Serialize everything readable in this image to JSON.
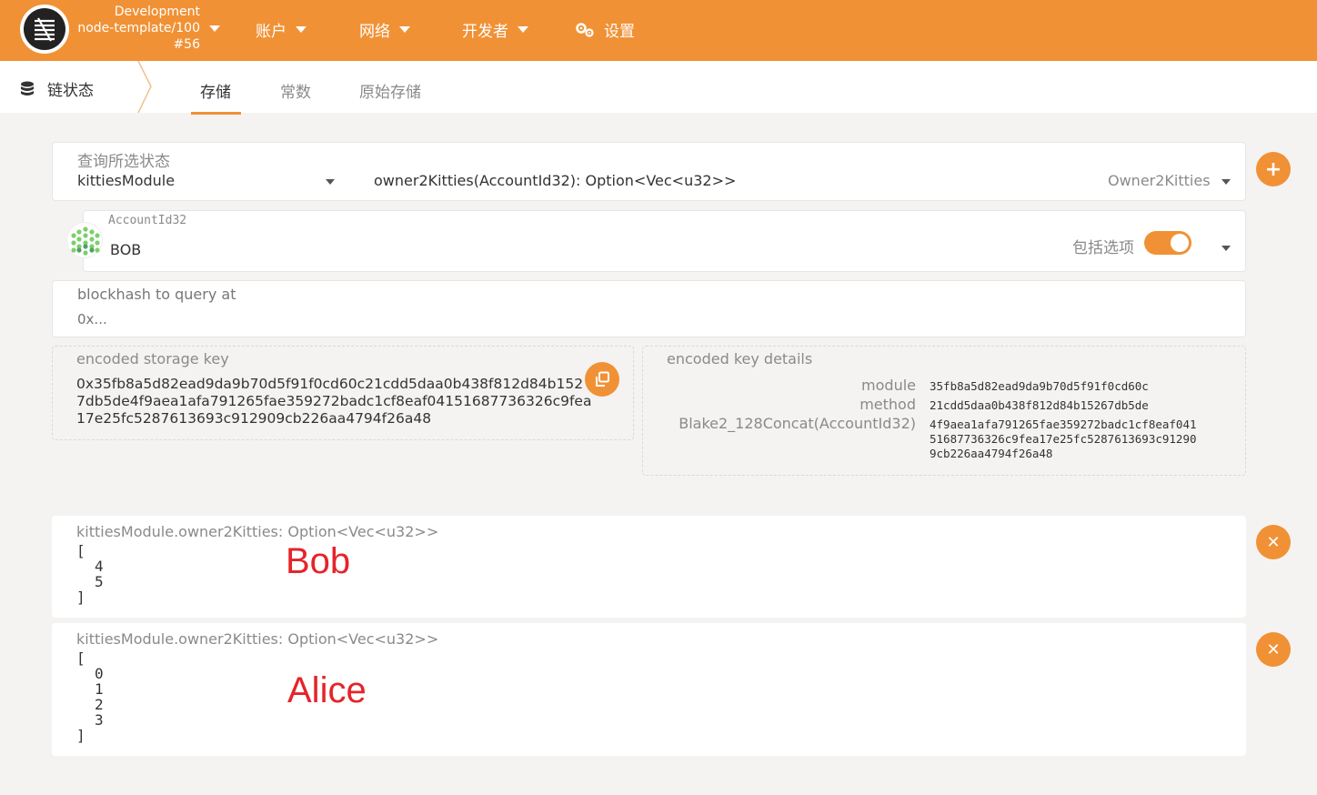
{
  "header": {
    "chain_name": "Development",
    "node_label": "node-template/100",
    "block_number": "#56",
    "menu": {
      "accounts": "账户",
      "network": "网络",
      "developer": "开发者",
      "settings": "设置"
    }
  },
  "subnav": {
    "section": "链状态",
    "tabs": [
      "存储",
      "常数",
      "原始存储"
    ]
  },
  "query": {
    "label": "查询所选状态",
    "module": "kittiesModule",
    "method": "owner2Kitties(AccountId32): Option<Vec<u32>>",
    "method_hint": "Owner2Kitties"
  },
  "account": {
    "label": "AccountId32",
    "value": "BOB",
    "include_option_label": "包括选项"
  },
  "blockhash": {
    "label": "blockhash to query at",
    "placeholder": "0x..."
  },
  "encoded_key": {
    "label": "encoded storage key",
    "lines": [
      "0x35fb8a5d82ead9da9b70d5f91f0cd60c21cdd5daa0b438f812d84b152",
      "7db5de4f9aea1afa791265fae359272badc1cf8eaf04151687736326c9fea",
      "17e25fc5287613693c912909cb226aa4794f26a48"
    ]
  },
  "key_details": {
    "label": "encoded key details",
    "rows": [
      {
        "key": "module",
        "value": [
          "35fb8a5d82ead9da9b70d5f91f0cd60c"
        ]
      },
      {
        "key": "method",
        "value": [
          "21cdd5daa0b438f812d84b15267db5de"
        ]
      },
      {
        "key": "Blake2_128Concat(AccountId32)",
        "value": [
          "4f9aea1afa791265fae359272badc1cf8eaf041",
          "51687736326c9fea17e25fc5287613693c91290",
          "9cb226aa4794f26a48"
        ]
      }
    ]
  },
  "results": [
    {
      "title": "kittiesModule.owner2Kitties: Option<Vec<u32>>",
      "open": "[",
      "items": [
        "4",
        "5"
      ],
      "close": "]",
      "annotation": "Bob"
    },
    {
      "title": "kittiesModule.owner2Kitties: Option<Vec<u32>>",
      "open": "[",
      "items": [
        "0",
        "1",
        "2",
        "3"
      ],
      "close": "]",
      "annotation": "Alice"
    }
  ],
  "icons": {
    "add": "plus-icon",
    "close": "close-icon",
    "copy": "copy-icon",
    "settings": "gears-icon",
    "database": "database-icon"
  },
  "colors": {
    "accent": "#f19135",
    "annotation": "#e6232b"
  }
}
